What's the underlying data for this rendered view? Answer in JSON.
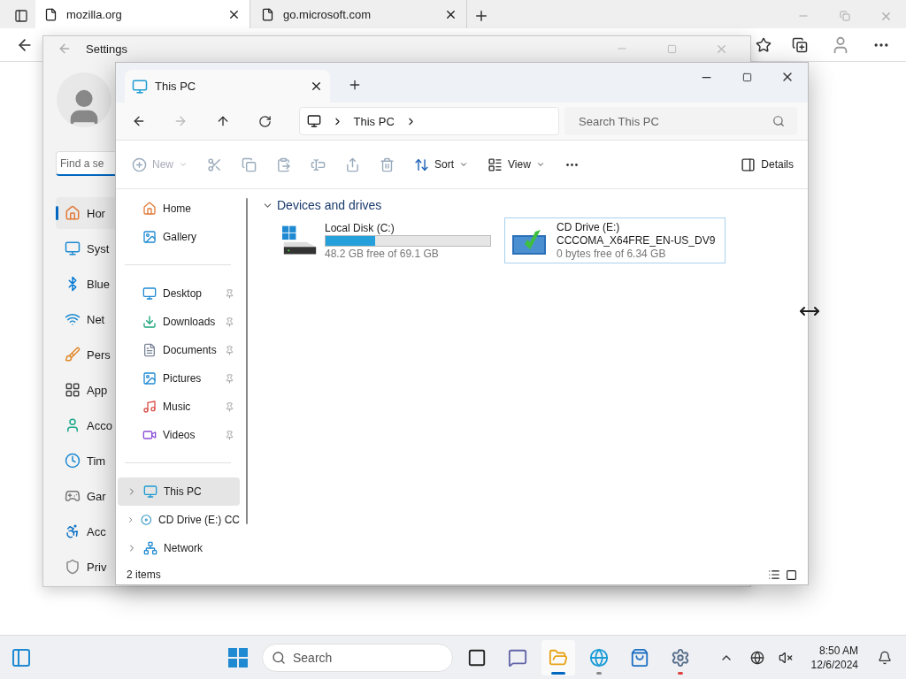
{
  "browser": {
    "tabs": [
      {
        "label": "mozilla.org",
        "selected": true
      },
      {
        "label": "go.microsoft.com",
        "selected": false
      }
    ]
  },
  "settings": {
    "title": "Settings",
    "search": {
      "placeholder": "Find a se"
    },
    "nav": [
      {
        "label": "Hor",
        "selected": true
      },
      {
        "label": "Syst",
        "selected": false
      },
      {
        "label": "Blue",
        "selected": false
      },
      {
        "label": "Net",
        "selected": false
      },
      {
        "label": "Pers",
        "selected": false
      },
      {
        "label": "App",
        "selected": false
      },
      {
        "label": "Acco",
        "selected": false
      },
      {
        "label": "Tim",
        "selected": false
      },
      {
        "label": "Gar",
        "selected": false
      },
      {
        "label": "Acc",
        "selected": false
      },
      {
        "label": "Priv",
        "selected": false
      }
    ]
  },
  "explorer": {
    "tab": {
      "label": "This PC"
    },
    "address": [
      "This PC"
    ],
    "search": {
      "placeholder": "Search This PC"
    },
    "toolbar": [
      {
        "kind": "new",
        "label": "New",
        "disabled": true
      },
      {
        "kind": "cut",
        "disabled": true
      },
      {
        "kind": "copy",
        "disabled": true
      },
      {
        "kind": "paste",
        "disabled": true
      },
      {
        "kind": "rename",
        "disabled": true
      },
      {
        "kind": "share",
        "disabled": true
      },
      {
        "kind": "delete",
        "disabled": true
      },
      {
        "kind": "sort",
        "label": "Sort",
        "disabled": false
      },
      {
        "kind": "view",
        "label": "View",
        "disabled": false
      },
      {
        "kind": "more",
        "disabled": false
      },
      {
        "kind": "details",
        "label": "Details",
        "disabled": false
      }
    ],
    "sidebar": [
      [
        {
          "label": "Home",
          "selected": false
        },
        {
          "label": "Gallery",
          "selected": false
        }
      ],
      [
        {
          "label": "Desktop",
          "pinned": true,
          "selected": false
        },
        {
          "label": "Downloads",
          "pinned": true,
          "selected": false
        },
        {
          "label": "Documents",
          "pinned": true,
          "selected": false
        },
        {
          "label": "Pictures",
          "pinned": true,
          "selected": false
        },
        {
          "label": "Music",
          "pinned": true,
          "selected": false
        },
        {
          "label": "Videos",
          "pinned": true,
          "selected": false
        }
      ],
      [
        {
          "label": "This PC",
          "expandable": true,
          "selected": true
        },
        {
          "label": "CD Drive (E:) CC",
          "expandable": true,
          "selected": false
        },
        {
          "label": "Network",
          "expandable": true,
          "selected": false
        }
      ]
    ],
    "section": {
      "title": "Devices and drives",
      "expanded": true
    },
    "drives": [
      {
        "kind": "disk",
        "name": "Local Disk (C:)",
        "level": 0.3,
        "free": "48.2 GB free of 69.1 GB",
        "selected": false
      },
      {
        "kind": "cd",
        "name": "CD Drive (E:)",
        "volume": "CCCOMA_X64FRE_EN-US_DV9",
        "free": "0 bytes free of 6.34 GB",
        "selected": true
      }
    ],
    "status": "2 items"
  },
  "taskbar": {
    "search": {
      "placeholder": "Search"
    },
    "apps": [
      {
        "kind": "taskview",
        "running": false,
        "active": false,
        "alert": false
      },
      {
        "kind": "chat",
        "running": false,
        "active": false,
        "alert": false
      },
      {
        "kind": "explorer",
        "running": true,
        "active": true,
        "alert": false
      },
      {
        "kind": "edge",
        "running": true,
        "active": false,
        "alert": false
      },
      {
        "kind": "store",
        "running": false,
        "active": false,
        "alert": false
      },
      {
        "kind": "settings",
        "running": true,
        "active": false,
        "alert": true
      }
    ],
    "time": "8:50 AM",
    "date": "12/6/2024"
  }
}
